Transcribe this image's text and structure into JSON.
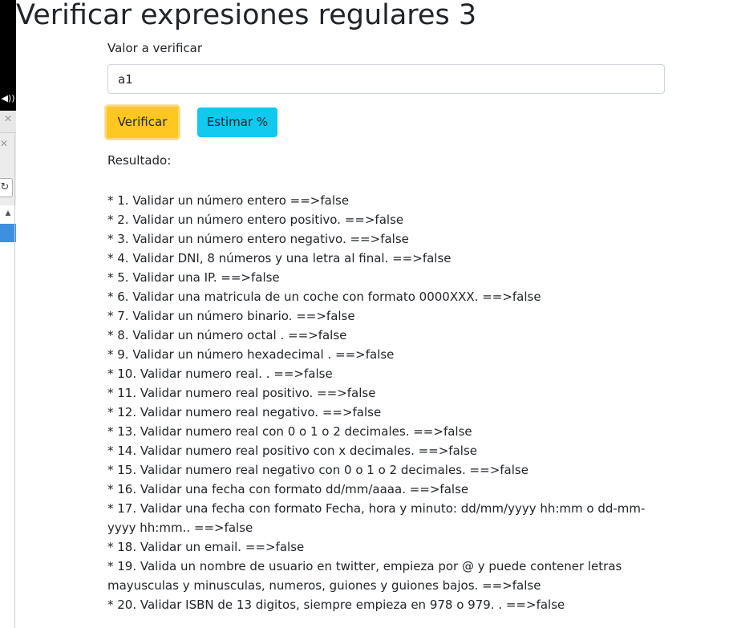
{
  "page": {
    "title": "Verificar expresiones regulares 3"
  },
  "form": {
    "label": "Valor a verificar",
    "value": "a1",
    "verify_button": "Verificar",
    "estimate_button": "Estimar %"
  },
  "result": {
    "label": "Resultado:",
    "items": [
      "* 1. Validar un número entero ==>false",
      "* 2. Validar un número entero positivo. ==>false",
      "* 3. Validar un número entero negativo. ==>false",
      "* 4. Validar DNI, 8 números y una letra al final. ==>false",
      "* 5. Validar una IP. ==>false",
      "* 6. Validar una matricula de un coche con formato 0000XXX. ==>false",
      "* 7. Validar un número binario. ==>false",
      "* 8. Validar un número octal . ==>false",
      "* 9. Validar un número hexadecimal . ==>false",
      "* 10. Validar numero real. . ==>false",
      "* 11. Validar numero real positivo. ==>false",
      "* 12. Validar numero real negativo. ==>false",
      "* 13. Validar numero real con 0 o 1 o 2 decimales. ==>false",
      "* 14. Validar numero real positivo con x decimales. ==>false",
      "* 15. Validar numero real negativo con 0 o 1 o 2 decimales. ==>false",
      "* 16. Validar una fecha con formato dd/mm/aaaa. ==>false",
      "* 17. Validar una fecha con formato Fecha, hora y minuto: dd/mm/yyyy hh:mm o dd-mm-yyyy hh:mm.. ==>false",
      "* 18. Validar un email. ==>false",
      "* 19. Valida un nombre de usuario en twitter, empieza por @ y puede contener letras mayusculas y minusculas, numeros, guiones y guiones bajos. ==>false",
      "* 20. Validar ISBN de 13 digitos, siempre empieza en 978 o 979. . ==>false"
    ]
  },
  "side_panel": {
    "speaker_icon": "speaker-icon",
    "close_icon": "close-icon",
    "refresh_icon": "refresh-icon",
    "scroll_up_icon": "scroll-up-arrow-icon",
    "selection_color": "#3d8fe0"
  },
  "colors": {
    "verify_button_bg": "#ffc721",
    "estimate_button_bg": "#11c8ef"
  }
}
